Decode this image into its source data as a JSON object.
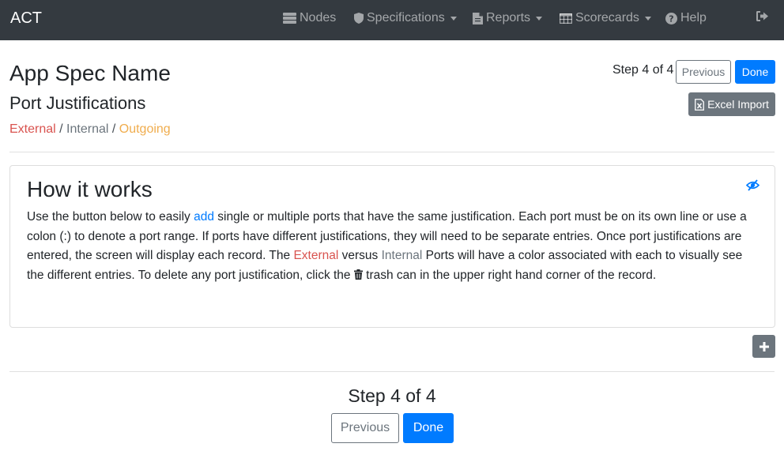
{
  "navbar": {
    "brand": "ACT",
    "items": [
      {
        "label": "Nodes",
        "icon": "server-icon"
      },
      {
        "label": "Specifications",
        "icon": "shield-icon",
        "dropdown": true
      },
      {
        "label": "Reports",
        "icon": "file-icon",
        "dropdown": true
      },
      {
        "label": "Scorecards",
        "icon": "table-icon",
        "dropdown": true
      },
      {
        "label": "Help",
        "icon": "question-circle-icon"
      }
    ],
    "logout_icon": "sign-out-icon"
  },
  "header": {
    "app_title": "App Spec Name",
    "subtitle": "Port Justifications",
    "legend": {
      "external": "External",
      "separator1": " / ",
      "internal": "Internal",
      "separator2": " / ",
      "outgoing": "Outgoing"
    },
    "step_label": "Step 4 of 4",
    "previous_label": "Previous",
    "done_label": "Done",
    "excel_import_label": "Excel Import"
  },
  "how_it_works": {
    "title": "How it works",
    "p1": "Use the button below to easily ",
    "add_link": "add",
    "p2": " single or multiple ports that have the same justification. Each port must be on its own line or use a colon (:) to denote a port range. If ports have different justifications, they will need to be separate entries. Once port justifications are entered, the screen will display each record. The ",
    "external": "External",
    "p3": " versus ",
    "internal": "Internal",
    "p4": " Ports will have a color associated with each to visually see the different entries. To delete any port justification, click the ",
    "p5": " trash can in the upper right hand corner of the record."
  },
  "footer": {
    "step_label": "Step 4 of 4",
    "previous_label": "Previous",
    "done_label": "Done"
  },
  "colors": {
    "navbar": "#343a40",
    "primary": "#007bff",
    "external": "#d9534f",
    "internal": "#6c757d",
    "outgoing": "#f0ad4e"
  }
}
